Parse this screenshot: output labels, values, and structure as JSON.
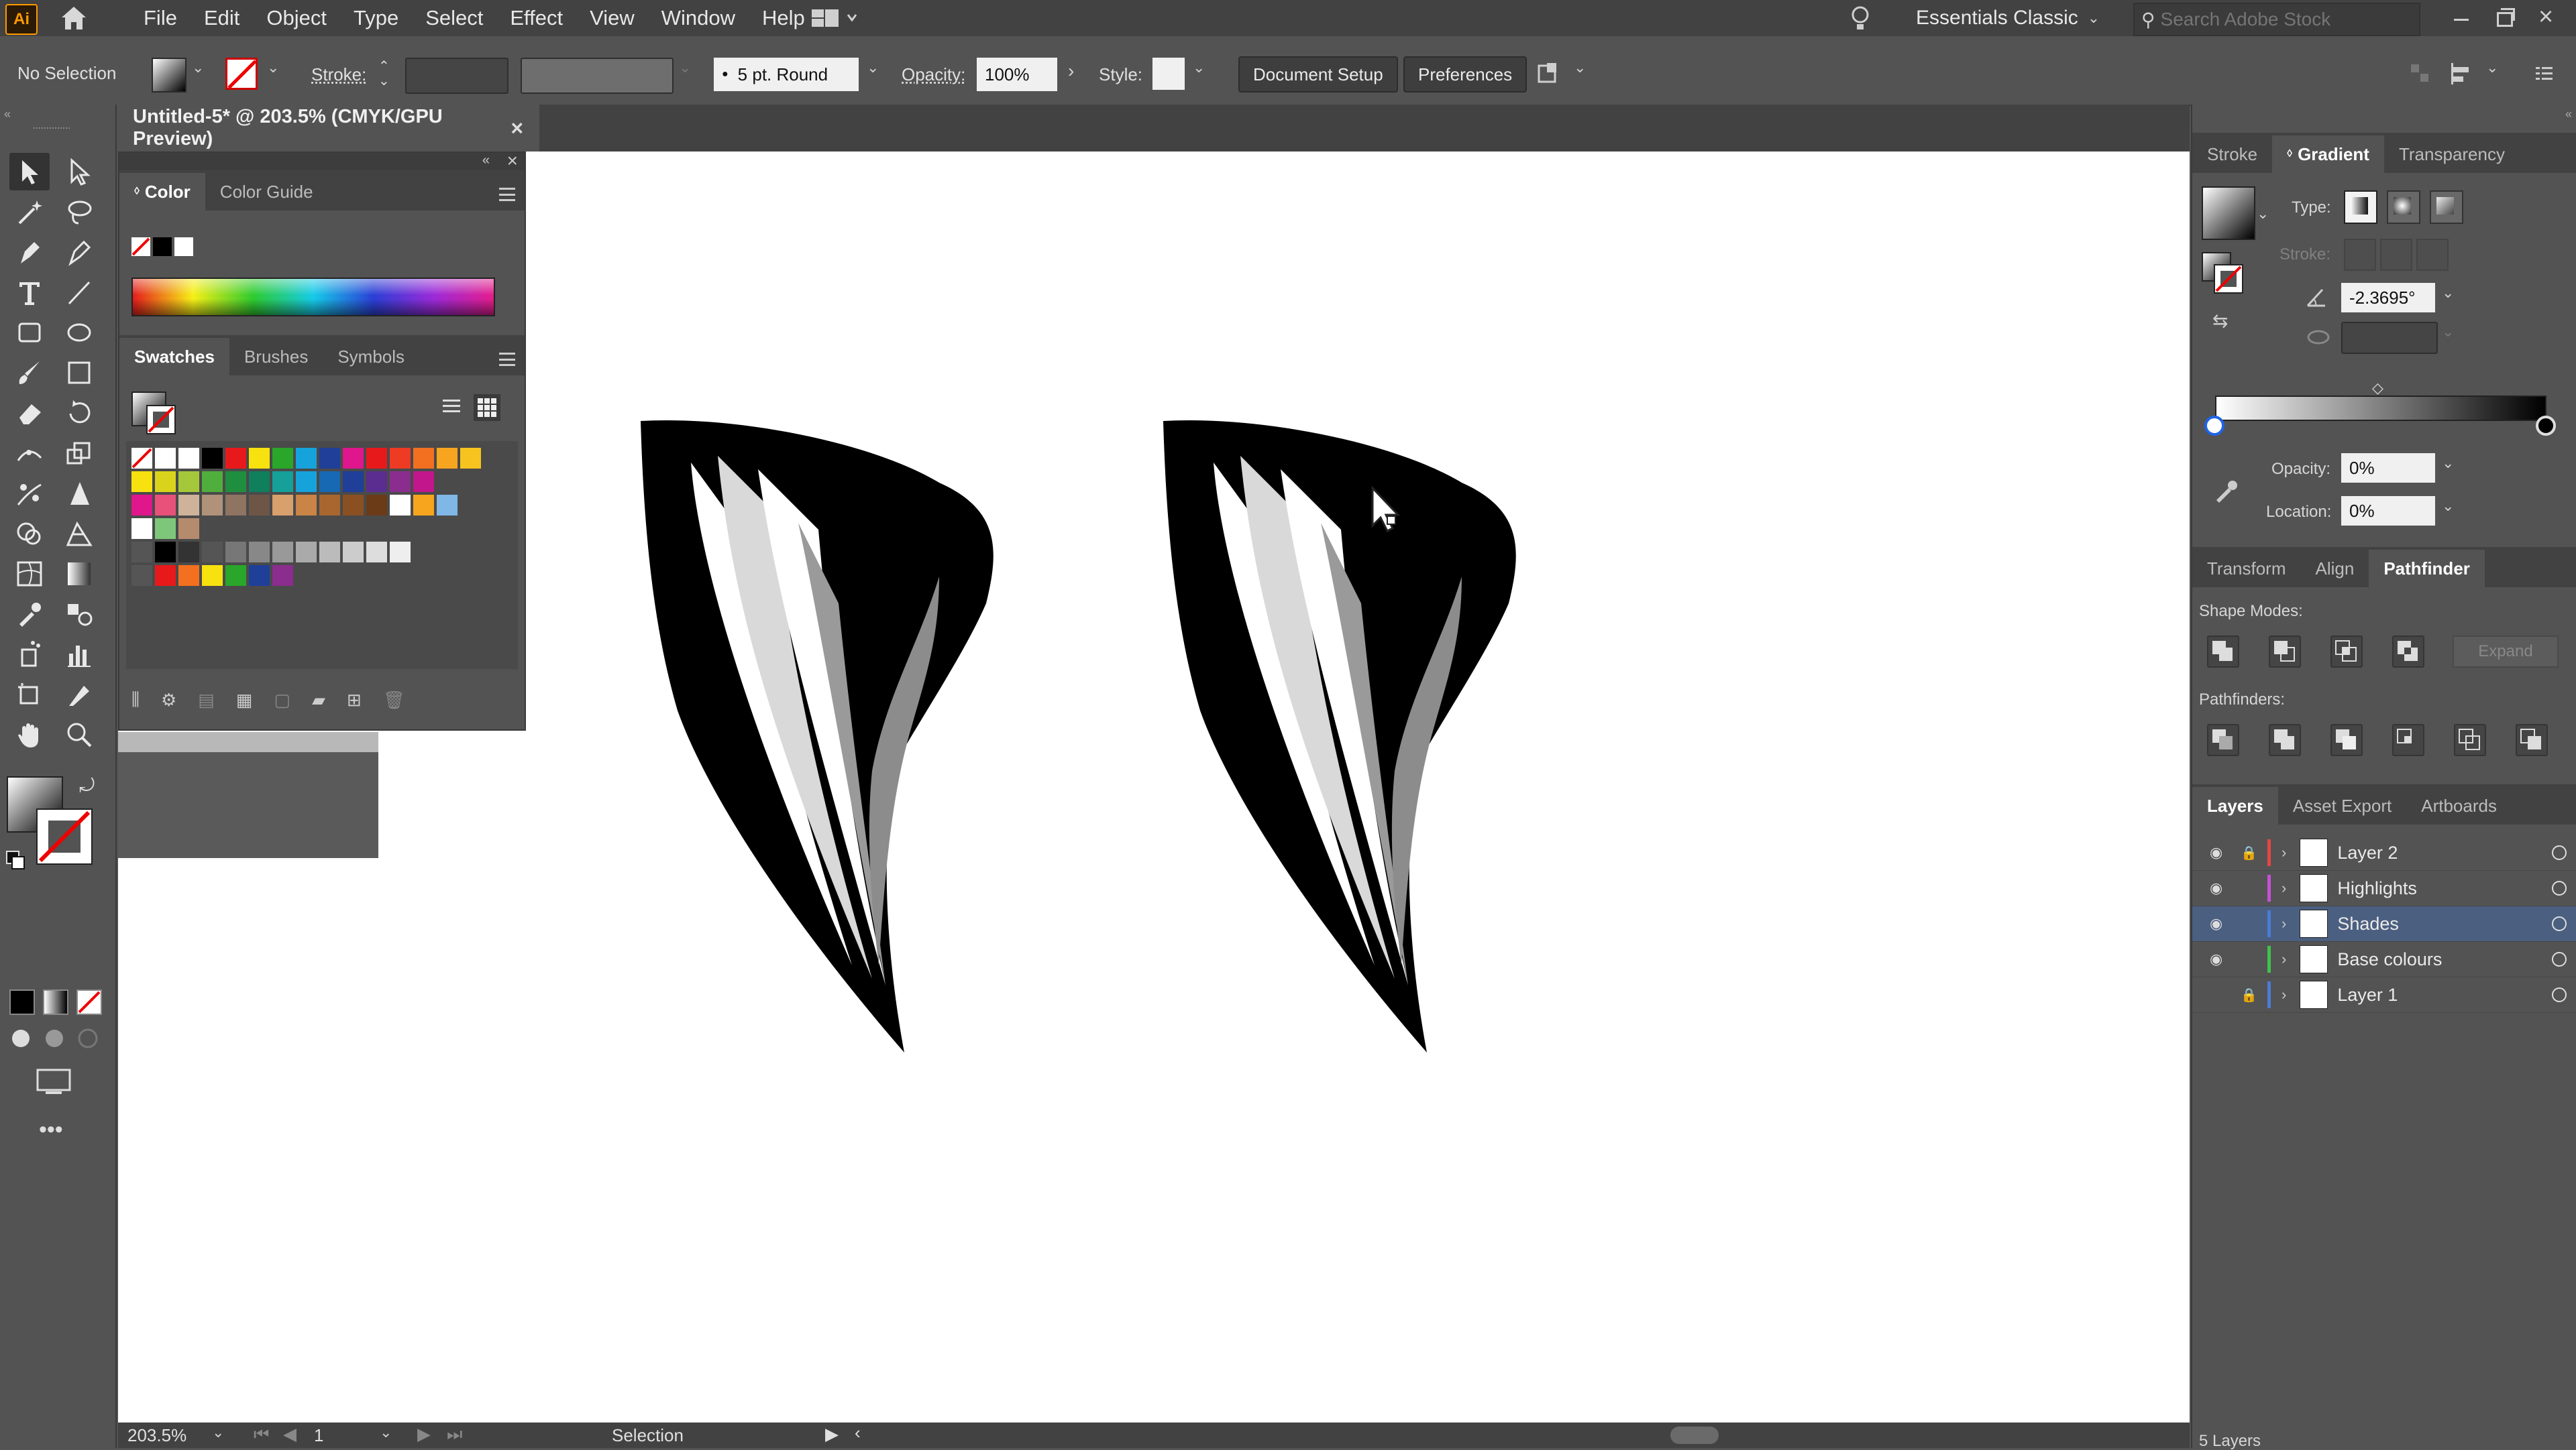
{
  "app": {
    "logo": "Ai"
  },
  "menu": [
    "File",
    "Edit",
    "Object",
    "Type",
    "Select",
    "Effect",
    "View",
    "Window",
    "Help"
  ],
  "workspace": {
    "name": "Essentials Classic",
    "search_placeholder": "Search Adobe Stock"
  },
  "control": {
    "selection": "No Selection",
    "stroke_label": "Stroke:",
    "brush": "5 pt. Round",
    "opacity_label": "Opacity:",
    "opacity_value": "100%",
    "style_label": "Style:",
    "document_setup": "Document Setup",
    "preferences": "Preferences"
  },
  "document": {
    "tab_title": "Untitled-5* @ 203.5% (CMYK/GPU Preview)"
  },
  "color_panel": {
    "tabs": [
      "Color",
      "Color Guide"
    ]
  },
  "swatches_panel": {
    "tabs": [
      "Swatches",
      "Brushes",
      "Symbols"
    ]
  },
  "right_panel": {
    "top_tabs": [
      "Stroke",
      "Gradient",
      "Transparency"
    ],
    "gradient": {
      "type_label": "Type:",
      "stroke_label": "Stroke:",
      "angle": "-2.3695°",
      "opacity_label": "Opacity:",
      "opacity": "0%",
      "location_label": "Location:",
      "location": "0%"
    },
    "mid_tabs": [
      "Transform",
      "Align",
      "Pathfinder"
    ],
    "pathfinder": {
      "shape_modes_label": "Shape Modes:",
      "expand_label": "Expand",
      "pathfinders_label": "Pathfinders:"
    },
    "bottom_tabs": [
      "Layers",
      "Asset Export",
      "Artboards"
    ],
    "layers": [
      {
        "name": "Layer 2",
        "color": "#e64545"
      },
      {
        "name": "Highlights",
        "color": "#c84fd8"
      },
      {
        "name": "Shades",
        "color": "#4a7bd6"
      },
      {
        "name": "Base colours",
        "color": "#3fc24f"
      },
      {
        "name": "Layer 1",
        "color": "#4a7bd6"
      }
    ]
  },
  "status": {
    "zoom": "203.5%",
    "artboard": "1",
    "tool": "Selection",
    "layers_count": "5 Layers"
  }
}
